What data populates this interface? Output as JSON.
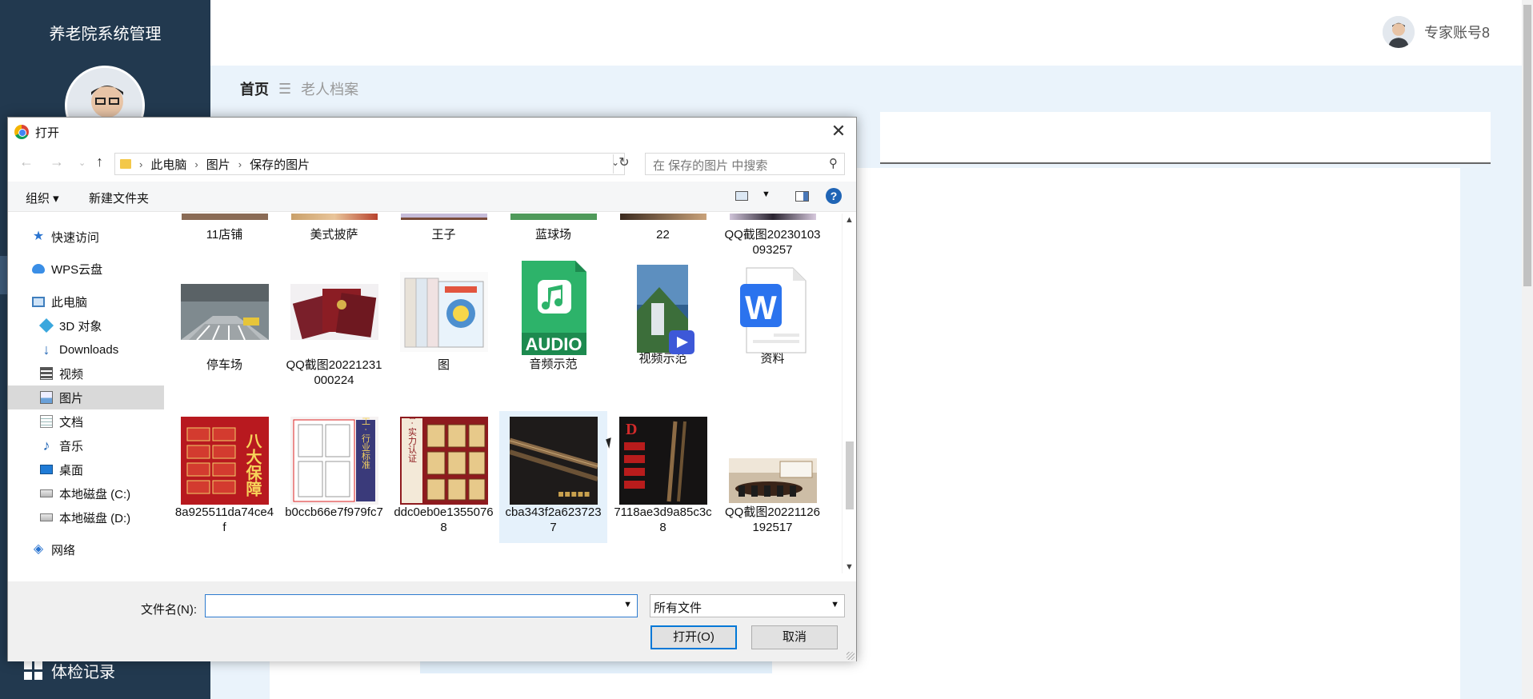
{
  "app": {
    "title": "养老院系统管理",
    "user_name": "专家账号8",
    "breadcrumb": {
      "home": "首页",
      "separator": "☰",
      "current": "老人档案"
    },
    "menu_bottom_label": "体检记录"
  },
  "dialog": {
    "title": "打开",
    "address": [
      "此电脑",
      "图片",
      "保存的图片"
    ],
    "search_placeholder": "在 保存的图片 中搜索",
    "toolbar": {
      "organize": "组织 ▾",
      "new_folder": "新建文件夹",
      "help": "?"
    },
    "nav": [
      {
        "label": "快速访问",
        "icon": "star-icon"
      },
      {
        "label": "WPS云盘",
        "icon": "cloud-icon"
      },
      {
        "label": "此电脑",
        "icon": "computer-icon"
      },
      {
        "label": "3D 对象",
        "icon": "cube-icon"
      },
      {
        "label": "Downloads",
        "icon": "download-icon"
      },
      {
        "label": "视频",
        "icon": "video-icon"
      },
      {
        "label": "图片",
        "icon": "pictures-icon",
        "selected": true
      },
      {
        "label": "文档",
        "icon": "document-icon"
      },
      {
        "label": "音乐",
        "icon": "music-icon"
      },
      {
        "label": "桌面",
        "icon": "desktop-icon"
      },
      {
        "label": "本地磁盘 (C:)",
        "icon": "drive-icon"
      },
      {
        "label": "本地磁盘 (D:)",
        "icon": "drive-icon"
      },
      {
        "label": "网络",
        "icon": "network-icon"
      }
    ],
    "files": [
      {
        "name": "11店铺"
      },
      {
        "name": "美式披萨"
      },
      {
        "name": "王子"
      },
      {
        "name": "蓝球场"
      },
      {
        "name": "22"
      },
      {
        "name": "QQ截图20230103093257"
      },
      {
        "name": "停车场"
      },
      {
        "name": "QQ截图20221231000224"
      },
      {
        "name": "图"
      },
      {
        "name": "音频示范"
      },
      {
        "name": "视频示范"
      },
      {
        "name": "资料"
      },
      {
        "name": "8a925511da74ce4f"
      },
      {
        "name": "b0ccb66e7f979fc7"
      },
      {
        "name": "ddc0eb0e13550768"
      },
      {
        "name": "cba343f2a6237237",
        "selected": true
      },
      {
        "name": "7118ae3d9a85c3c8"
      },
      {
        "name": "QQ截图20221126192517"
      }
    ],
    "thumb_text": {
      "audio": "AUDIO",
      "wps": "W",
      "poster1": "八大保障",
      "poster2": "严苛做工 · 行业标准",
      "poster3": "多项荣誉 · 实力认证"
    },
    "filename_label": "文件名(N):",
    "filename_value": "",
    "filetype": "所有文件",
    "open_button": "打开(O)",
    "cancel_button": "取消"
  }
}
